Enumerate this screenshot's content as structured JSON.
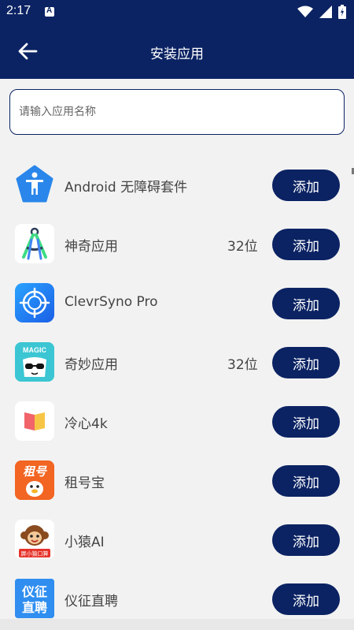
{
  "status": {
    "time": "2:17"
  },
  "header": {
    "title": "安装应用"
  },
  "search": {
    "placeholder": "请输入应用名称",
    "value": ""
  },
  "apps": [
    {
      "name": "Android 无障碍套件",
      "bits": "",
      "add_label": "添加",
      "icon": "accessibility-icon"
    },
    {
      "name": "神奇应用",
      "bits": "32位",
      "add_label": "添加",
      "icon": "compass-icon"
    },
    {
      "name": "ClevrSyno Pro",
      "bits": "",
      "add_label": "添加",
      "icon": "target-icon"
    },
    {
      "name": "奇妙应用",
      "bits": "32位",
      "add_label": "添加",
      "icon": "magic-icon"
    },
    {
      "name": "冷心4k",
      "bits": "",
      "add_label": "添加",
      "icon": "book-icon"
    },
    {
      "name": "租号宝",
      "bits": "",
      "add_label": "添加",
      "icon": "zuhaobao-icon"
    },
    {
      "name": "小猿AI",
      "bits": "",
      "add_label": "添加",
      "icon": "monkey-icon"
    },
    {
      "name": "仪征直聘",
      "bits": "",
      "add_label": "添加",
      "icon": "yizheng-icon"
    }
  ],
  "icon_texts": {
    "magic": "MAGIC",
    "zuhao": "租号",
    "xiaoyuan": "屏小猿口算",
    "yizheng_top": "仪征",
    "yizheng_bottom": "直聘"
  },
  "colors": {
    "primary": "#0b2363",
    "background": "#f2f2f2"
  }
}
